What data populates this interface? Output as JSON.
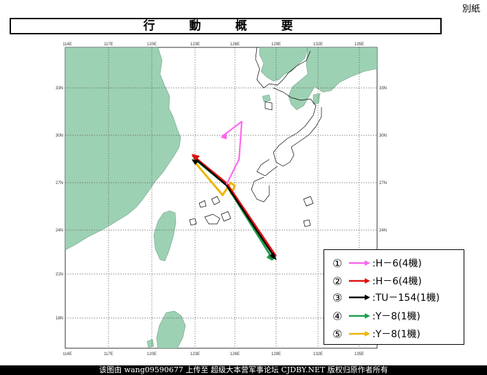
{
  "corner_label": "別紙",
  "title": "行 動 概 要",
  "map": {
    "x_ticks": [
      "114E",
      "117E",
      "120E",
      "123E",
      "126E",
      "129E",
      "132E",
      "135E"
    ],
    "y_ticks": [
      "33N",
      "30N",
      "27N",
      "24N",
      "21N",
      "18N"
    ],
    "colors": {
      "land": "#9dd1b4",
      "land_stroke": "#6f9f86",
      "grid": "#555555"
    }
  },
  "routes": [
    {
      "num": "①",
      "label": ":H－6(4機)",
      "color": "#ff66ee"
    },
    {
      "num": "②",
      "label": ":H－6(4機)",
      "color": "#e01010"
    },
    {
      "num": "③",
      "label": ":TU－154(1機)",
      "color": "#000000"
    },
    {
      "num": "④",
      "label": ":Y－8(1機)",
      "color": "#19a04a"
    },
    {
      "num": "⑤",
      "label": ":Y－8(1機)",
      "color": "#f0b400"
    }
  ],
  "footer": "该图由 wang09590677 上传至 超级大本营军事论坛 CJDBY.NET 版权归原作者所有"
}
